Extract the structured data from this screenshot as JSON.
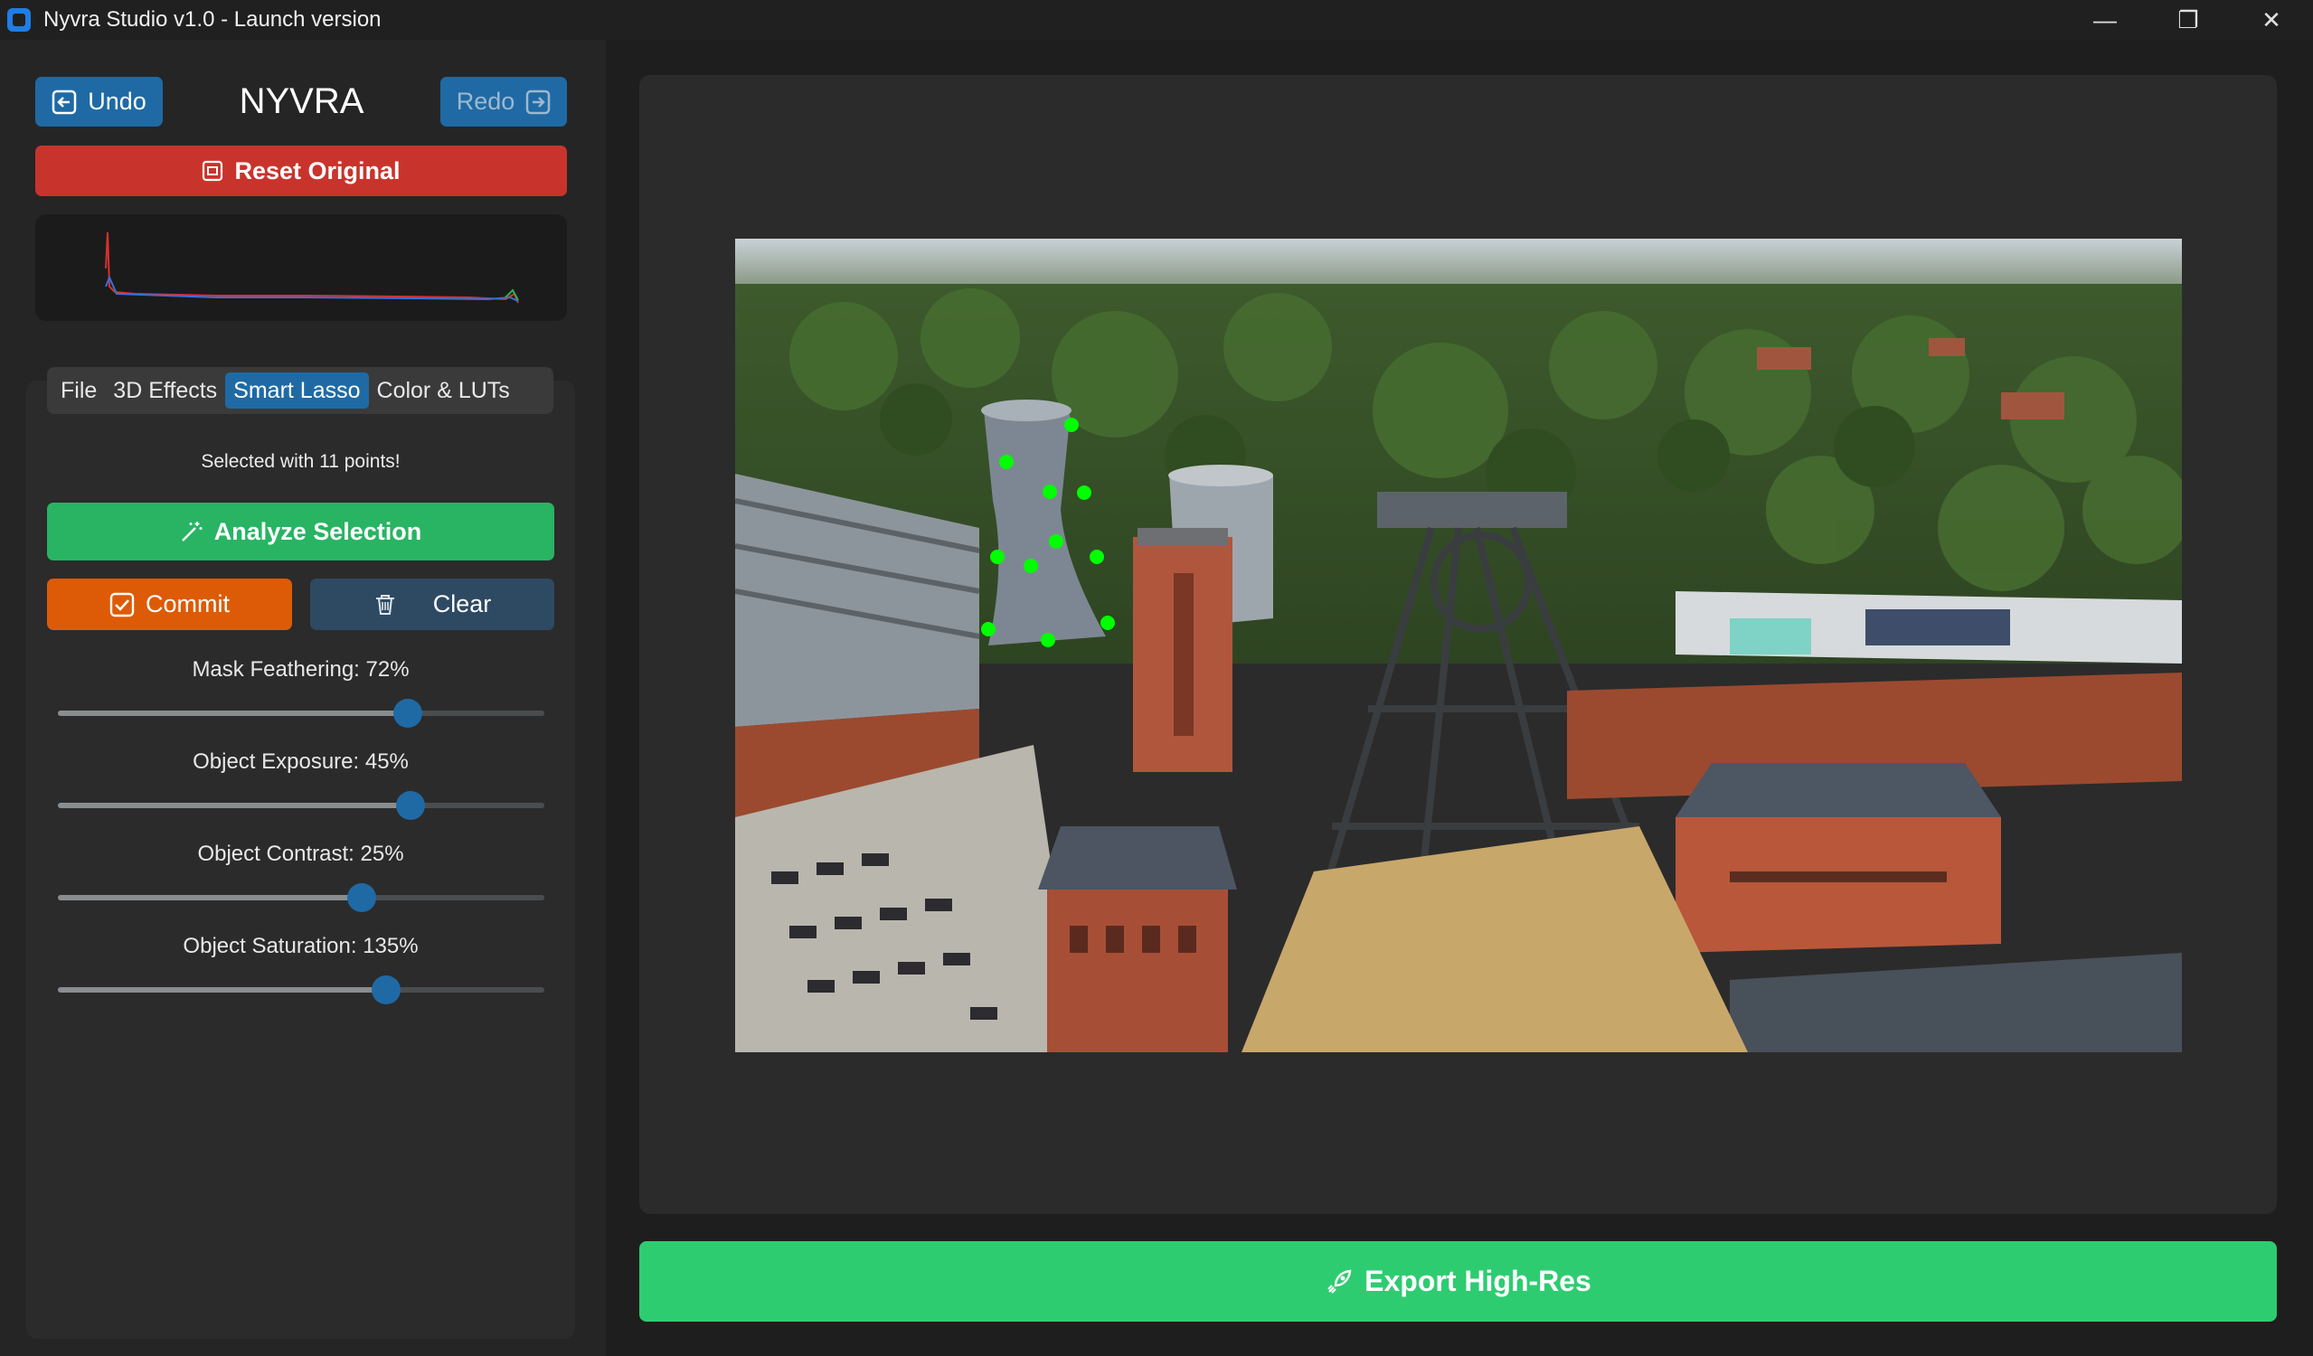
{
  "window": {
    "title": "Nyvra Studio v1.0 - Launch version",
    "minimize": "—",
    "maximize": "❐",
    "close": "✕"
  },
  "toolbar": {
    "undo_label": "Undo",
    "redo_label": "Redo",
    "brand": "NYVRA",
    "reset_label": "Reset Original"
  },
  "tabs": [
    {
      "label": "File",
      "active": false
    },
    {
      "label": "3D Effects",
      "active": false
    },
    {
      "label": "Smart Lasso",
      "active": true
    },
    {
      "label": "Color & LUTs",
      "active": false
    }
  ],
  "lasso": {
    "status": "Selected with 11 points!",
    "analyze_label": "Analyze Selection",
    "commit_label": "Commit",
    "clear_label": "Clear"
  },
  "sliders": [
    {
      "label": "Mask Feathering: 72%",
      "level": 0.72
    },
    {
      "label": "Object Exposure: 45%",
      "level": 0.725
    },
    {
      "label": "Object Contrast: 25%",
      "level": 0.625
    },
    {
      "label": "Object Saturation: 135%",
      "level": 0.675
    }
  ],
  "export": {
    "label": "Export High-Res"
  },
  "colors": {
    "accent": "#1f6aa5",
    "danger": "#c8342c",
    "success": "#28b463",
    "warning": "#dd5b06",
    "lasso_point": "#00ff00"
  }
}
